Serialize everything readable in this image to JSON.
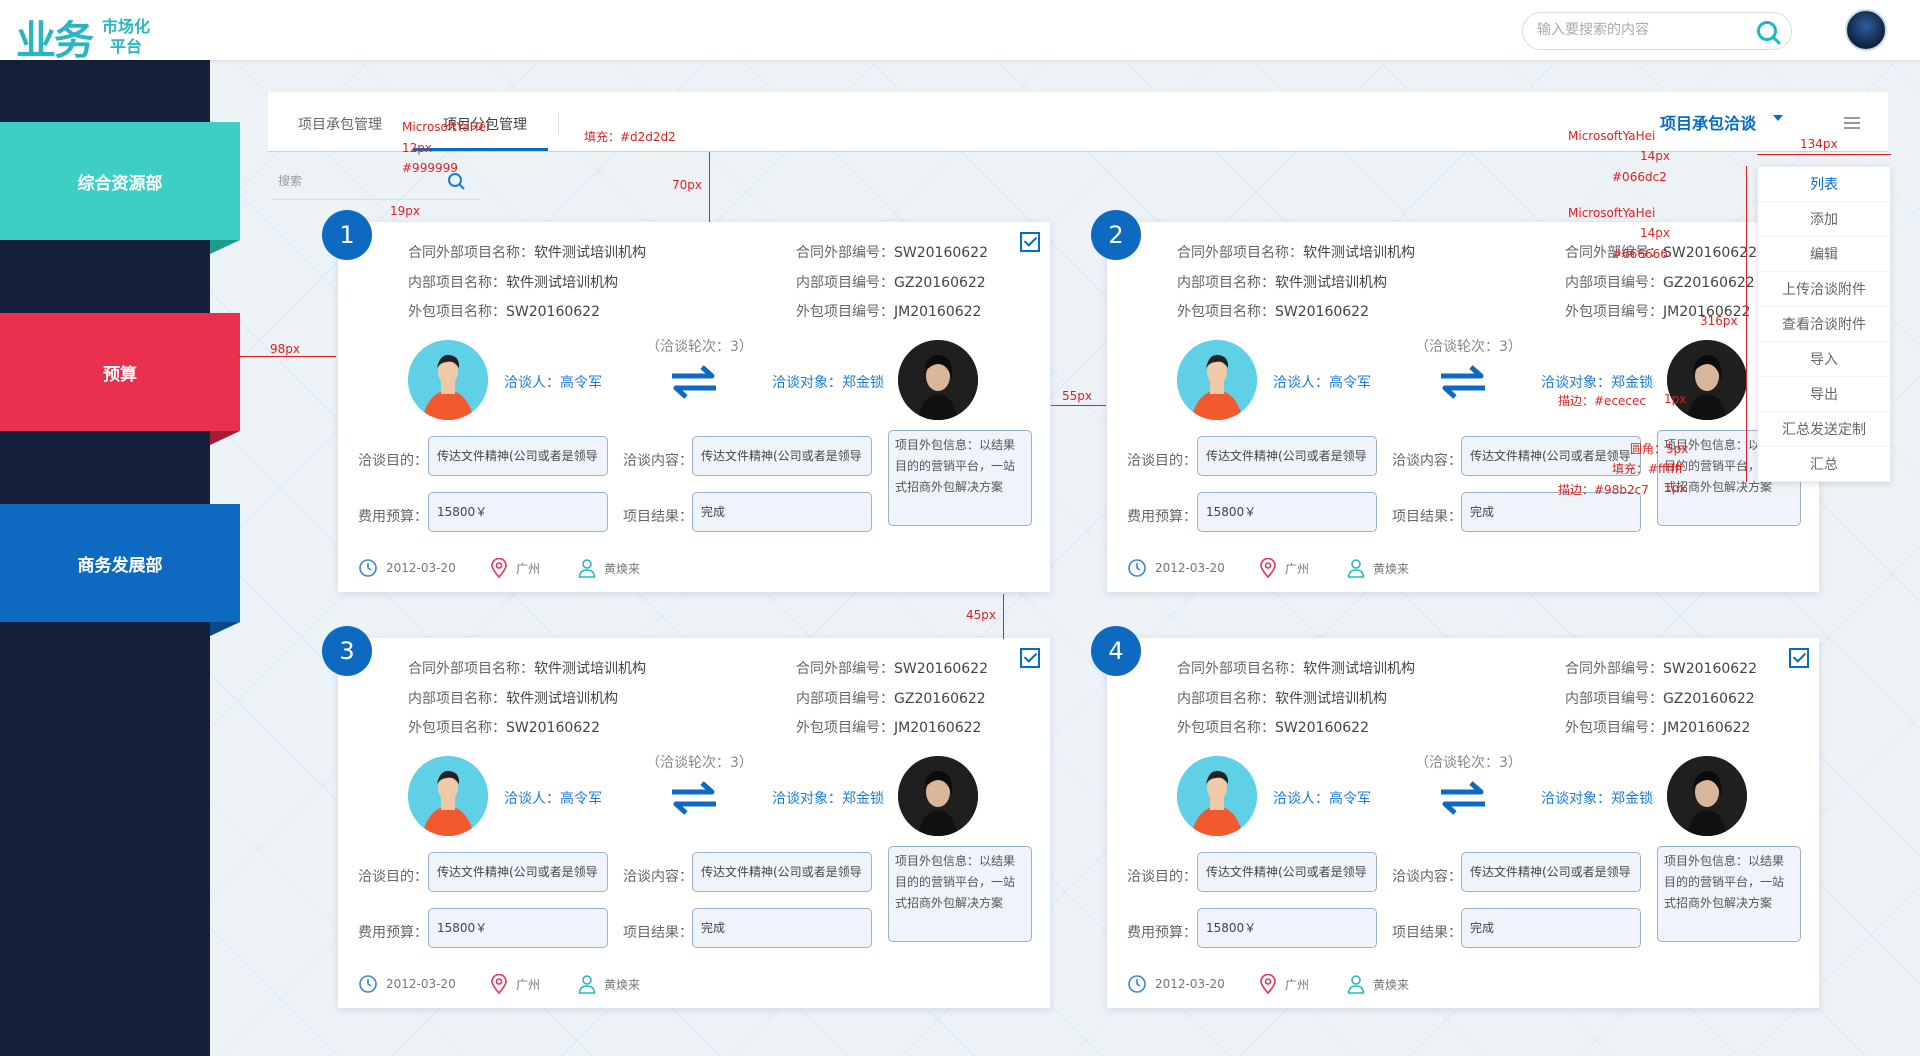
{
  "header": {
    "logo_mark": "业务",
    "logo_sub_1": "市场化",
    "logo_sub_2": "平台",
    "search_placeholder": "输入要搜索的内容"
  },
  "sidebar": {
    "items": [
      {
        "label": "综合资源部",
        "color": "#3dcfc3"
      },
      {
        "label": "预算",
        "color": "#e9304f"
      },
      {
        "label": "商务发展部",
        "color": "#0e6ac0"
      }
    ]
  },
  "tabs": {
    "items": [
      {
        "label": "项目承包管理"
      },
      {
        "label": "项目分包管理"
      }
    ],
    "dropdown_title": "项目承包洽谈"
  },
  "search2": {
    "placeholder": "搜索"
  },
  "dropdown": {
    "items": [
      "列表",
      "添加",
      "编辑",
      "上传洽谈附件",
      "查看洽谈附件",
      "导入",
      "导出",
      "汇总发送定制",
      "汇总"
    ]
  },
  "cards": [
    {
      "num": "1",
      "checked": true
    },
    {
      "num": "2",
      "checked": false
    },
    {
      "num": "3",
      "checked": true
    },
    {
      "num": "4",
      "checked": true
    }
  ],
  "card_content": {
    "ext_name_label": "合同外部项目名称：",
    "ext_name": "软件测试培训机构",
    "int_name_label": "内部项目名称：",
    "int_name": "软件测试培训机构",
    "out_name_label": "外包项目名称：",
    "out_name": "SW20160622",
    "ext_no_label": "合同外部编号：",
    "ext_no": "SW20160622",
    "int_no_label": "内部项目编号：",
    "int_no": "GZ20160622",
    "out_no_label": "外包项目编号：",
    "out_no": "JM20160622",
    "round": "（洽谈轮次：3）",
    "negotiator": "洽谈人：高令军",
    "target": "洽谈对象：郑金锁",
    "purpose_label": "洽谈目的：",
    "purpose": "传达文件精神(公司或者是领导",
    "content_label": "洽谈内容：",
    "content": "传达文件精神(公司或者是领导",
    "budget_label": "费用预算：",
    "budget": "15800￥",
    "result_label": "项目结果：",
    "result": "完成",
    "note": "项目外包信息：以结果目的的营销平台，一站式招商外包解决方案",
    "date": "2012-03-20",
    "city": "广州",
    "person": "黄焕来"
  },
  "annotations": {
    "font_a": "MicrosoftYaHei",
    "size_12": "12px",
    "color_999": "#999999",
    "fill_d2": "填充：#d2d2d2",
    "gap_70": "70px",
    "gap_19": "19px",
    "gap_98": "98px",
    "gap_55": "55px",
    "gap_45": "45px",
    "font_b": "MicrosoftYaHei",
    "size_14a": "14px",
    "color_066": "#066dc2",
    "font_c": "MicrosoftYaHei",
    "size_14b": "14px",
    "color_666": "#666666",
    "w_134": "134px",
    "h_316": "316px",
    "border_ec": "描边：#ececec",
    "w_1px_a": "1px",
    "radius": "圆角：5px",
    "fill_ff": "填充：#ffffff",
    "border_98": "描边：#98b2c7",
    "w_1px_b": "1px"
  }
}
